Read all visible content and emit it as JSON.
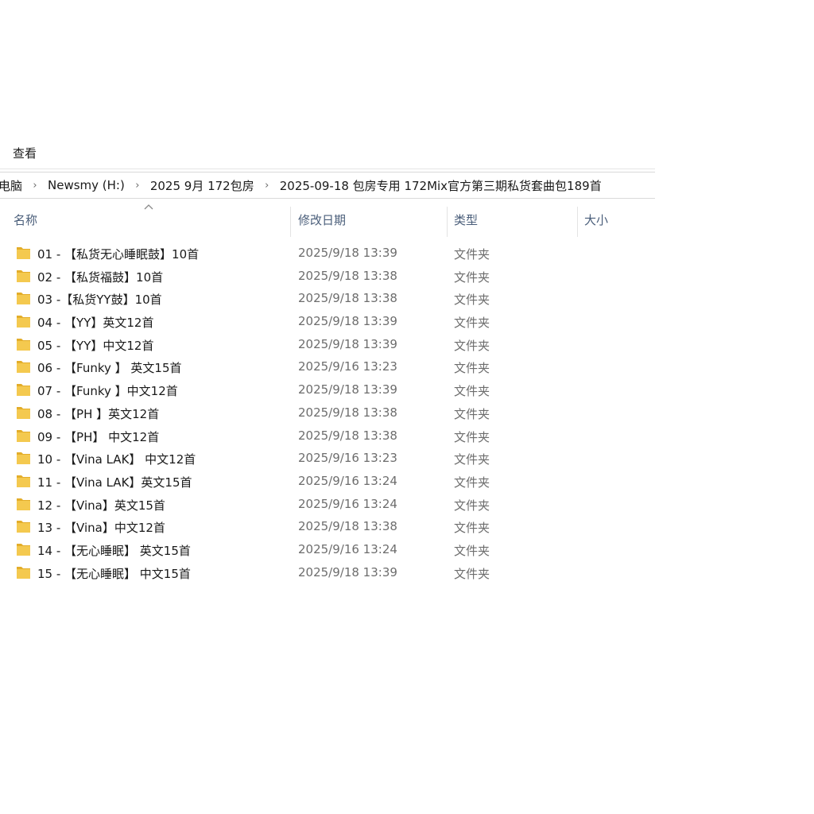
{
  "ribbon": {
    "view_tab": "查看"
  },
  "address": {
    "crumbs": [
      "电脑",
      "Newsmy (H:)",
      "2025 9月 172包房",
      "2025-09-18 包房专用  172Mix官方第三期私货套曲包189首"
    ],
    "separator": "›"
  },
  "columns": {
    "name": "名称",
    "date": "修改日期",
    "type": "类型",
    "size": "大小"
  },
  "colors": {
    "folder": "#f4c94f",
    "folder_dark": "#e3ad2a",
    "header_text": "#4a5e7a"
  },
  "icons": {
    "folder": "folder-icon",
    "sort": "sort-up-icon"
  },
  "rows": [
    {
      "name": "01 - 【私货无心睡眠鼓】10首",
      "date": "2025/9/18 13:39",
      "type": "文件夹"
    },
    {
      "name": "02 - 【私货福鼓】10首",
      "date": "2025/9/18 13:38",
      "type": "文件夹"
    },
    {
      "name": "03 -【私货YY鼓】10首",
      "date": "2025/9/18 13:38",
      "type": "文件夹"
    },
    {
      "name": "04 - 【YY】英文12首",
      "date": "2025/9/18 13:39",
      "type": "文件夹"
    },
    {
      "name": "05 - 【YY】中文12首",
      "date": "2025/9/18 13:39",
      "type": "文件夹"
    },
    {
      "name": "06 - 【Funky 】 英文15首",
      "date": "2025/9/16 13:23",
      "type": "文件夹"
    },
    {
      "name": "07 - 【Funky 】中文12首",
      "date": "2025/9/18 13:39",
      "type": "文件夹"
    },
    {
      "name": "08 - 【PH 】英文12首",
      "date": "2025/9/18 13:38",
      "type": "文件夹"
    },
    {
      "name": "09 - 【PH】 中文12首",
      "date": "2025/9/18 13:38",
      "type": "文件夹"
    },
    {
      "name": "10 - 【Vina LAK】 中文12首",
      "date": "2025/9/16 13:23",
      "type": "文件夹"
    },
    {
      "name": "11 - 【Vina LAK】英文15首",
      "date": "2025/9/16 13:24",
      "type": "文件夹"
    },
    {
      "name": "12 - 【Vina】英文15首",
      "date": "2025/9/16 13:24",
      "type": "文件夹"
    },
    {
      "name": "13 - 【Vina】中文12首",
      "date": "2025/9/18 13:38",
      "type": "文件夹"
    },
    {
      "name": "14 - 【无心睡眠】 英文15首",
      "date": "2025/9/16 13:24",
      "type": "文件夹"
    },
    {
      "name": "15 - 【无心睡眠】 中文15首",
      "date": "2025/9/18 13:39",
      "type": "文件夹"
    }
  ]
}
